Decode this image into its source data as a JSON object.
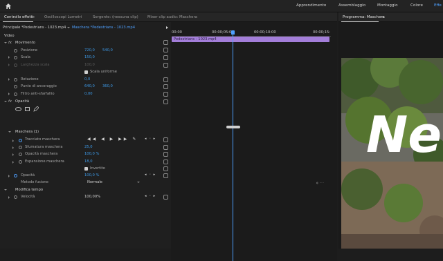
{
  "workspaces": [
    "Apprendimento",
    "Assemblaggio",
    "Montaggio",
    "Colore",
    "Effe"
  ],
  "tabs": {
    "effect_controls": "Controllo effetti",
    "lumetri": "Oscilloscopi Lumetri",
    "source": "Sorgente: (nessuna clip)",
    "mixer": "Mixer clip audio: Maschera",
    "program": "Programma: Maschera"
  },
  "breadcrumb": {
    "master": "Principale *Pedestrians - 1023.mp4",
    "clip": "Maschera *Pedestrians - 1023.mp4"
  },
  "timeline": {
    "ticks": [
      "00:00",
      "00:00;05:00",
      "00:00;10:00",
      "00:00;15:"
    ],
    "clip_name": "Pedestrians - 1023.mp4",
    "colors": {
      "clip": "#a37ed9",
      "playhead": "#4ea0ff"
    }
  },
  "sections": {
    "video": "Video",
    "motion": "Movimento",
    "opacity_group": "Opacità",
    "mask": "Maschera (1)",
    "time_remap": "Modifica tempo"
  },
  "motion": {
    "position_label": "Posizione",
    "position_x": "720,0",
    "position_y": "540,0",
    "scale_label": "Scala",
    "scale": "150,0",
    "scale_width_label": "Larghezza scala",
    "scale_width": "100,0",
    "uniform_label": "Scala uniforme",
    "rotation_label": "Rotazione",
    "rotation": "0,0",
    "anchor_label": "Punto di ancoraggio",
    "anchor_x": "640,0",
    "anchor_y": "360,0",
    "flicker_label": "Filtro anti-sfarfallio",
    "flicker": "0,00"
  },
  "mask": {
    "path_label": "Tracciato maschera",
    "feather_label": "Sfumatura maschera",
    "feather": "25,0",
    "opacity_label": "Opacità maschera",
    "opacity": "100,0 %",
    "expansion_label": "Espansione maschera",
    "expansion": "18,0",
    "inverted_label": "Invertito"
  },
  "opacity": {
    "label": "Opacità",
    "value": "100,0 %",
    "blend_label": "Metodo fusione",
    "blend_value": "Normale"
  },
  "speed": {
    "label": "Velocità",
    "value": "100,00%"
  },
  "program_title": "Ne"
}
